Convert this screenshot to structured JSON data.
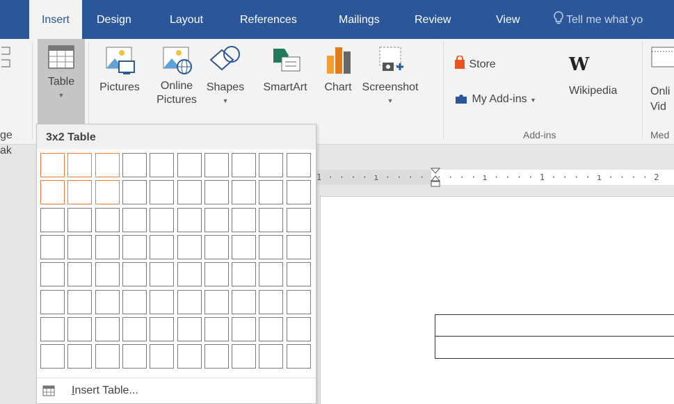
{
  "tabs": [
    {
      "label": "Insert",
      "active": true
    },
    {
      "label": "Design"
    },
    {
      "label": "Layout"
    },
    {
      "label": "References"
    },
    {
      "label": "Mailings"
    },
    {
      "label": "Review"
    },
    {
      "label": "View"
    }
  ],
  "tell_me": "Tell me what yo",
  "ribbon": {
    "left_fragment": [
      "ge",
      "ak"
    ],
    "table": "Table",
    "pictures": "Pictures",
    "online_pictures": [
      "Online",
      "Pictures"
    ],
    "shapes": "Shapes",
    "smartart": "SmartArt",
    "chart": "Chart",
    "screenshot": "Screenshot",
    "store": "Store",
    "my_addins": "My Add-ins",
    "wikipedia": "Wikipedia",
    "wikipedia_glyph": "W",
    "online_video": [
      "Onli",
      "Vid"
    ],
    "group_addins": "Add-ins",
    "group_media": "Med"
  },
  "ruler": "1 · · · · ı · · · ·  · · · · ı · · · · 1 · · · · ı · · · · 2",
  "dropdown": {
    "title": "3x2 Table",
    "grid": {
      "cols": 10,
      "rows": 8,
      "selected_cols": 3,
      "selected_rows": 2
    },
    "insert_table_prefix": "I",
    "insert_table_rest": "nsert Table..."
  },
  "colors": {
    "accent": "#2b579a",
    "highlight": "#e57f3f"
  }
}
